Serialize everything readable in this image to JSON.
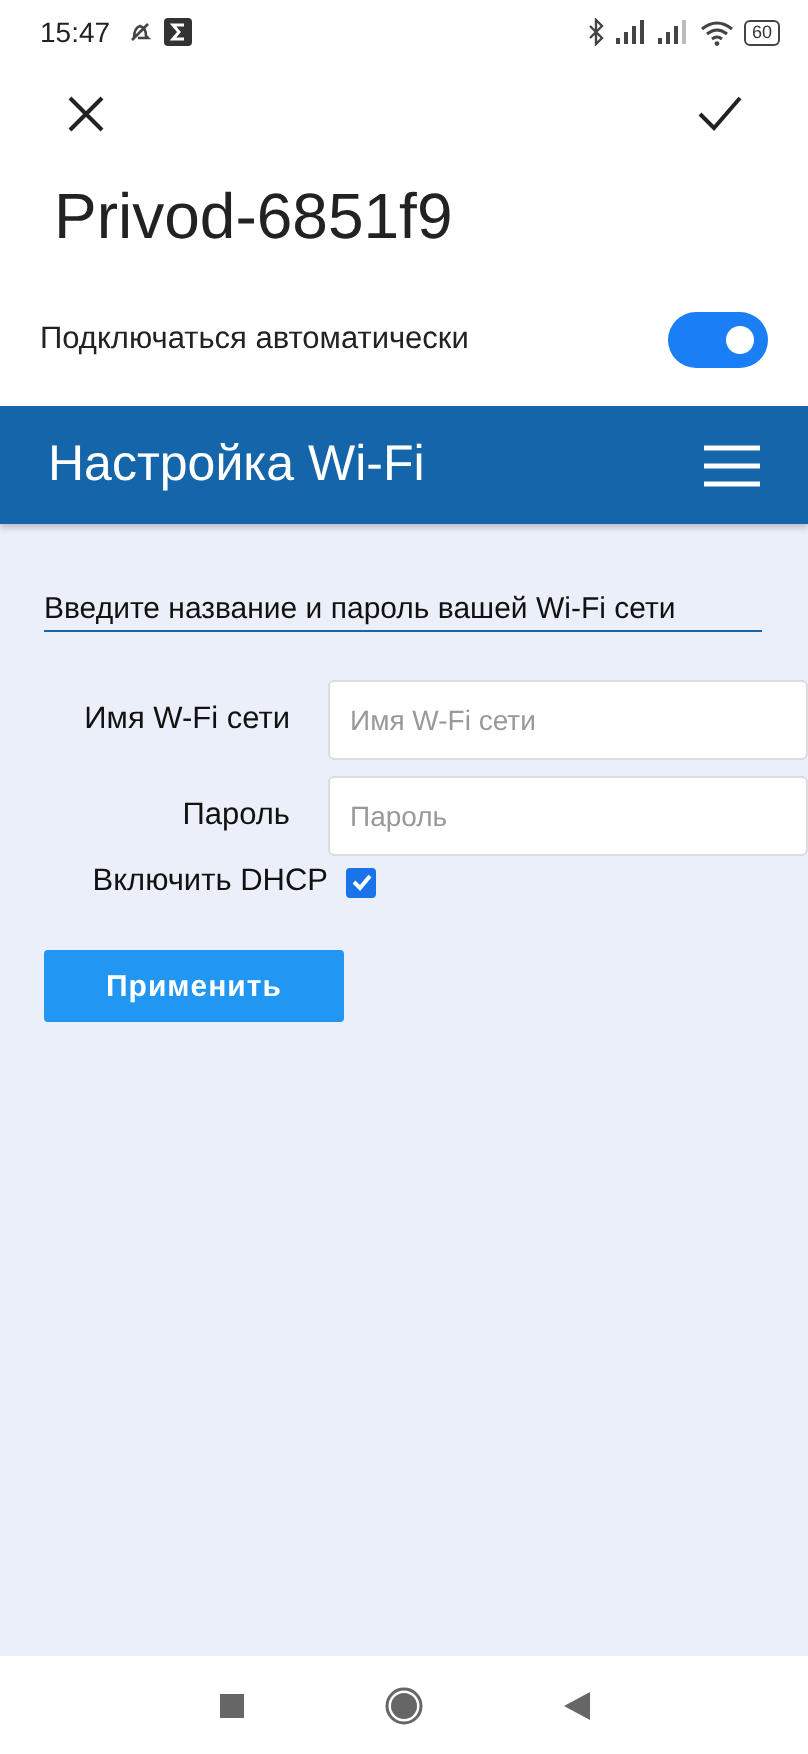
{
  "status_bar": {
    "time": "15:47",
    "battery": "60"
  },
  "header": {
    "title": "Privod-6851f9"
  },
  "auto_connect": {
    "label": "Подключаться автоматически",
    "on": true
  },
  "web_page": {
    "title": "Настройка Wi-Fi",
    "heading": "Введите название и пароль вашей Wi-Fi сети",
    "fields": [
      {
        "label": "Имя W-Fi сети",
        "placeholder": "Имя W-Fi сети"
      },
      {
        "label": "Пароль",
        "placeholder": "Пароль"
      }
    ],
    "dhcp": {
      "label": "Включить DHCP",
      "checked": true
    },
    "apply_button": "Применить"
  }
}
